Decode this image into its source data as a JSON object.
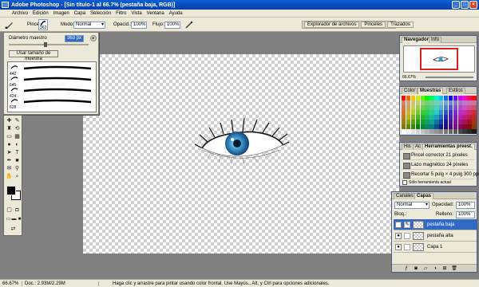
{
  "title": "Adobe Photoshop - [Sin título-1 al 66.7% (pestaña baja, RGB)]",
  "menu": [
    "Archivo",
    "Edición",
    "Imagen",
    "Capa",
    "Selección",
    "Filtro",
    "Vista",
    "Ventana",
    "Ayuda"
  ],
  "options": {
    "brush_label": "Pincel:",
    "brush_size": "363",
    "mode_label": "Modo:",
    "mode_value": "Normal",
    "opacity_label": "Opacid.:",
    "opacity_value": "100%",
    "flow_label": "Flujo:",
    "flow_value": "100%"
  },
  "well_tabs": [
    "Explorador de archivos",
    "Pinceles",
    "Trazados"
  ],
  "brush_popup": {
    "master_label": "Diámetro maestro",
    "master_value": "363 px",
    "sample_button": "Usar tamaño de muestra",
    "sizes": [
      "442",
      "645",
      "424",
      "628"
    ]
  },
  "navigator": {
    "tabs": [
      "Navegador",
      "Info"
    ],
    "zoom": "66.67%"
  },
  "color_panel": {
    "tabs": [
      "Color",
      "Muestras",
      "Estilos"
    ]
  },
  "history": {
    "tabs": [
      "His",
      "Ac",
      "Herramientas preest."
    ],
    "items": [
      "Pincel corrector 21 píxeles",
      "Lazo magnético 24 píxeles",
      "Recortar 5 pulg × 4 pulg 300 ppi"
    ],
    "checkbox_label": "Sólo herramienta actual"
  },
  "layers": {
    "tabs": [
      "Canales",
      "Capas"
    ],
    "mode": "Normal",
    "opacity_label": "Opacidad:",
    "opacity_value": "100%",
    "lock_label": "Bloq.:",
    "fill_label": "Relleno:",
    "fill_value": "100%",
    "items": [
      {
        "name": "pestaña baja",
        "selected": true
      },
      {
        "name": "pestaña alta",
        "selected": false
      },
      {
        "name": "Capa 1",
        "selected": false
      }
    ]
  },
  "status": {
    "zoom": "66.67%",
    "doc": "Doc.: 2.93M/2.29M",
    "hint": "Haga clic y arrastre para pintar usando color frontal. Use Mayús., Alt, y Ctrl para opciones adicionales."
  },
  "colors": {
    "titlebar": "#0a4fc0",
    "selected_layer": "#316ac5",
    "eye_iris": "#3a9ad0"
  },
  "icons": [
    "photoshop-logo",
    "brush-icon",
    "airbrush-icon",
    "minimize-icon",
    "maximize-icon",
    "close-icon",
    "eye-visibility-icon",
    "chain-link-icon",
    "new-layer-icon",
    "trash-icon"
  ]
}
